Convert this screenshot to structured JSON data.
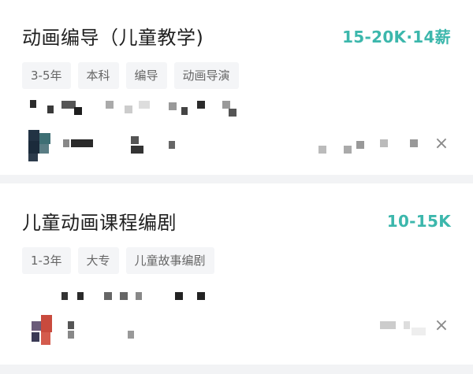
{
  "jobs": [
    {
      "title": "动画编导（儿童教学)",
      "salary": "15-20K·14薪",
      "tags": [
        "3-5年",
        "本科",
        "编导",
        "动画导演"
      ],
      "close_icon": "close-icon",
      "avatar_icon": "avatar"
    },
    {
      "title": "儿童动画课程编剧",
      "salary": "10-15K",
      "tags": [
        "1-3年",
        "大专",
        "儿童故事编剧"
      ],
      "close_icon": "close-icon",
      "avatar_icon": "avatar"
    }
  ],
  "colors": {
    "salary": "#3cb7ac",
    "background": "#f2f3f5",
    "tag_bg": "#f4f5f7"
  }
}
